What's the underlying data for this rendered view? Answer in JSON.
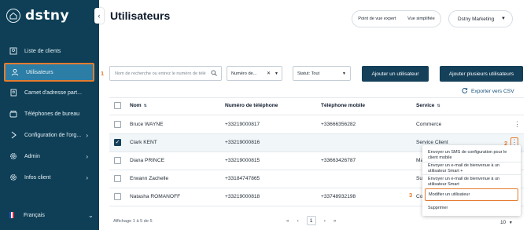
{
  "sidebar": {
    "logo": "dstny",
    "items": [
      {
        "label": "Liste de clients"
      },
      {
        "label": "Utilisateurs"
      },
      {
        "label": "Carnet d'adresse part..."
      },
      {
        "label": "Téléphones de bureau"
      },
      {
        "label": "Configuration de l'org..."
      },
      {
        "label": "Admin"
      },
      {
        "label": "Infos client"
      }
    ],
    "language": "Français"
  },
  "header": {
    "title": "Utilisateurs",
    "view_expert": "Point de vue expert",
    "view_simple": "Vue simplifiée",
    "company": "Dstny Marketing"
  },
  "filters": {
    "search_placeholder": "Nom de recherche ou entrez le numéro de télé",
    "number_filter": "Numéro de...",
    "status_filter": "Statut: Tout",
    "add_user": "Ajouter un utilisateur",
    "add_multiple": "Ajouter plusieurs utilisateurs",
    "export": "Exporter vers CSV"
  },
  "table": {
    "columns": [
      "Nom",
      "Numéro de téléphone",
      "Téléphone mobile",
      "Service"
    ],
    "rows": [
      {
        "name": "Bruce WAYNE",
        "phone": "+33219000817",
        "mobile": "+33666356282",
        "service": "Commerce",
        "checked": false
      },
      {
        "name": "Clark KENT",
        "phone": "+33219000816",
        "mobile": "",
        "service": "Service Client",
        "checked": true
      },
      {
        "name": "Diana PRINCE",
        "phone": "+33219000815",
        "mobile": "+33663426787",
        "service": "Ma",
        "checked": false
      },
      {
        "name": "Erwann Zachelle",
        "phone": "+33184747865",
        "mobile": "",
        "service": "Su",
        "checked": false
      },
      {
        "name": "Natasha ROMANOFF",
        "phone": "+33219000818",
        "mobile": "+33748932198",
        "service": "Co",
        "checked": false
      }
    ]
  },
  "footer": {
    "range": "Affichage 1 à 5 de 5",
    "prev2": "«",
    "prev": "‹",
    "page": "1",
    "next": "›",
    "next2": "»",
    "page_size": "10"
  },
  "menu": {
    "items": [
      "Envoyer un SMS de configuration pour le client mobile",
      "Envoyer un e-mail de bienvenue à un utilisateur Smart +",
      "Envoyer un e-mail de bienvenue à un utilisateur Smart",
      "Modifier un utilisateur",
      "Supprimer"
    ]
  },
  "callouts": [
    "1",
    "2",
    "3"
  ],
  "colors": {
    "sidebar_bg": "#0e3f56",
    "active_item": "#2c7ea6",
    "highlight": "#e57c2f",
    "primary_button": "#14405a"
  }
}
